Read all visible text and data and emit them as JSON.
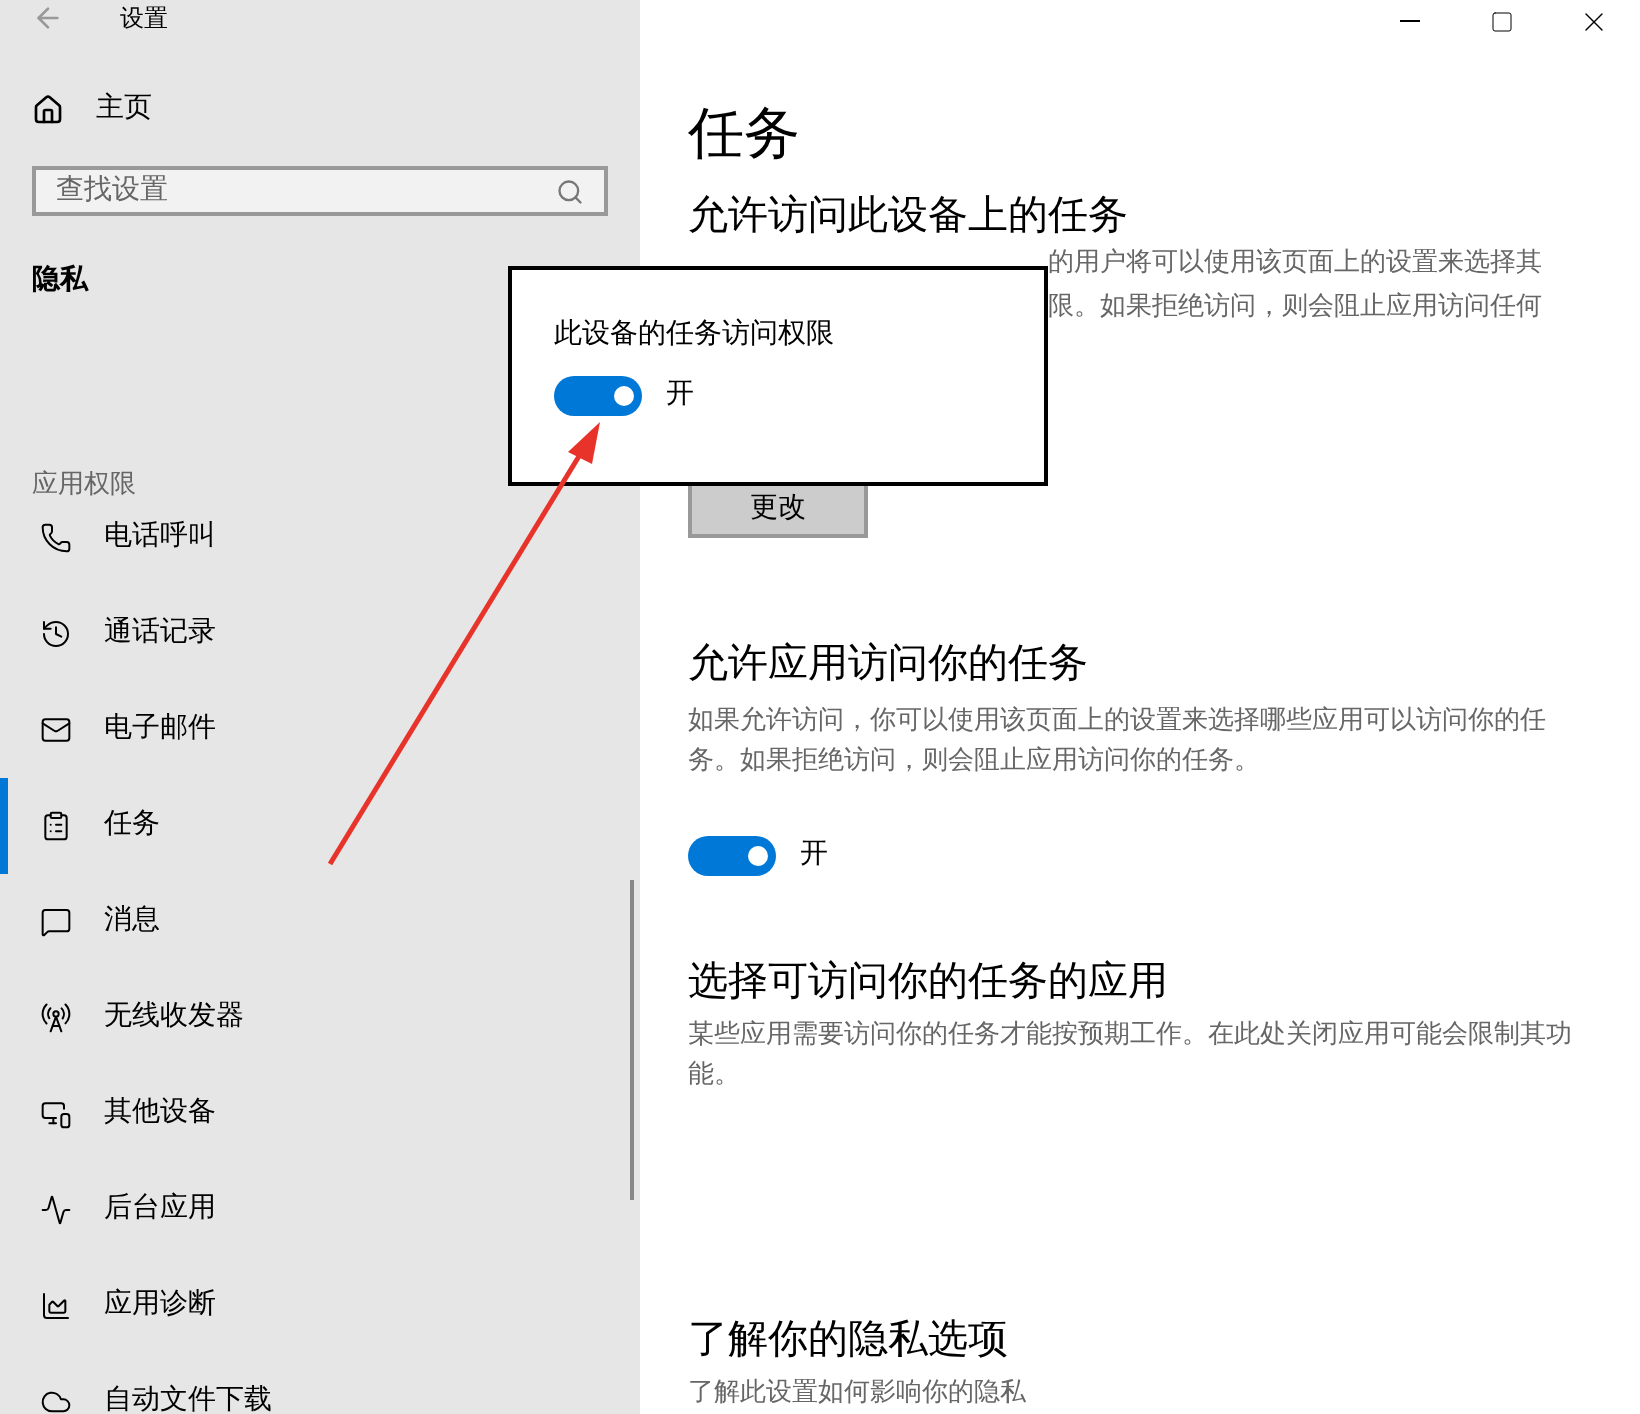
{
  "window": {
    "title": "设置"
  },
  "sidebar": {
    "home": "主页",
    "search": {
      "placeholder": "查找设置"
    },
    "section": "隐私",
    "group": "应用权限",
    "items": [
      {
        "label": "电话呼叫",
        "selected": false
      },
      {
        "label": "通话记录",
        "selected": false
      },
      {
        "label": "电子邮件",
        "selected": false
      },
      {
        "label": "任务",
        "selected": true
      },
      {
        "label": "消息",
        "selected": false
      },
      {
        "label": "无线收发器",
        "selected": false
      },
      {
        "label": "其他设备",
        "selected": false
      },
      {
        "label": "后台应用",
        "selected": false
      },
      {
        "label": "应用诊断",
        "selected": false
      },
      {
        "label": "自动文件下载",
        "selected": false
      }
    ]
  },
  "main": {
    "title": "任务",
    "sections": [
      {
        "kind": "button",
        "heading": "允许访问此设备上的任务",
        "lines": [
          "的用户将可以使用该页面上的设置来选择其",
          "限。如果拒绝访问，则会阻止应用访问任何"
        ],
        "button": "更改"
      },
      {
        "kind": "toggle",
        "heading": "允许应用访问你的任务",
        "description": "如果允许访问，你可以使用该页面上的设置来选择哪些应用可以访问你的任务。如果拒绝访问，则会阻止应用访问你的任务。",
        "toggle": {
          "on": true,
          "label": "开"
        }
      },
      {
        "kind": "text",
        "heading": "选择可访问你的任务的应用",
        "description": "某些应用需要访问你的任务才能按预期工作。在此处关闭应用可能会限制其功能。"
      },
      {
        "kind": "text",
        "heading": "了解你的隐私选项",
        "description": "了解此设置如何影响你的隐私"
      }
    ]
  },
  "popup": {
    "label": "此设备的任务访问权限",
    "toggle": {
      "on": true,
      "label": "开"
    }
  }
}
